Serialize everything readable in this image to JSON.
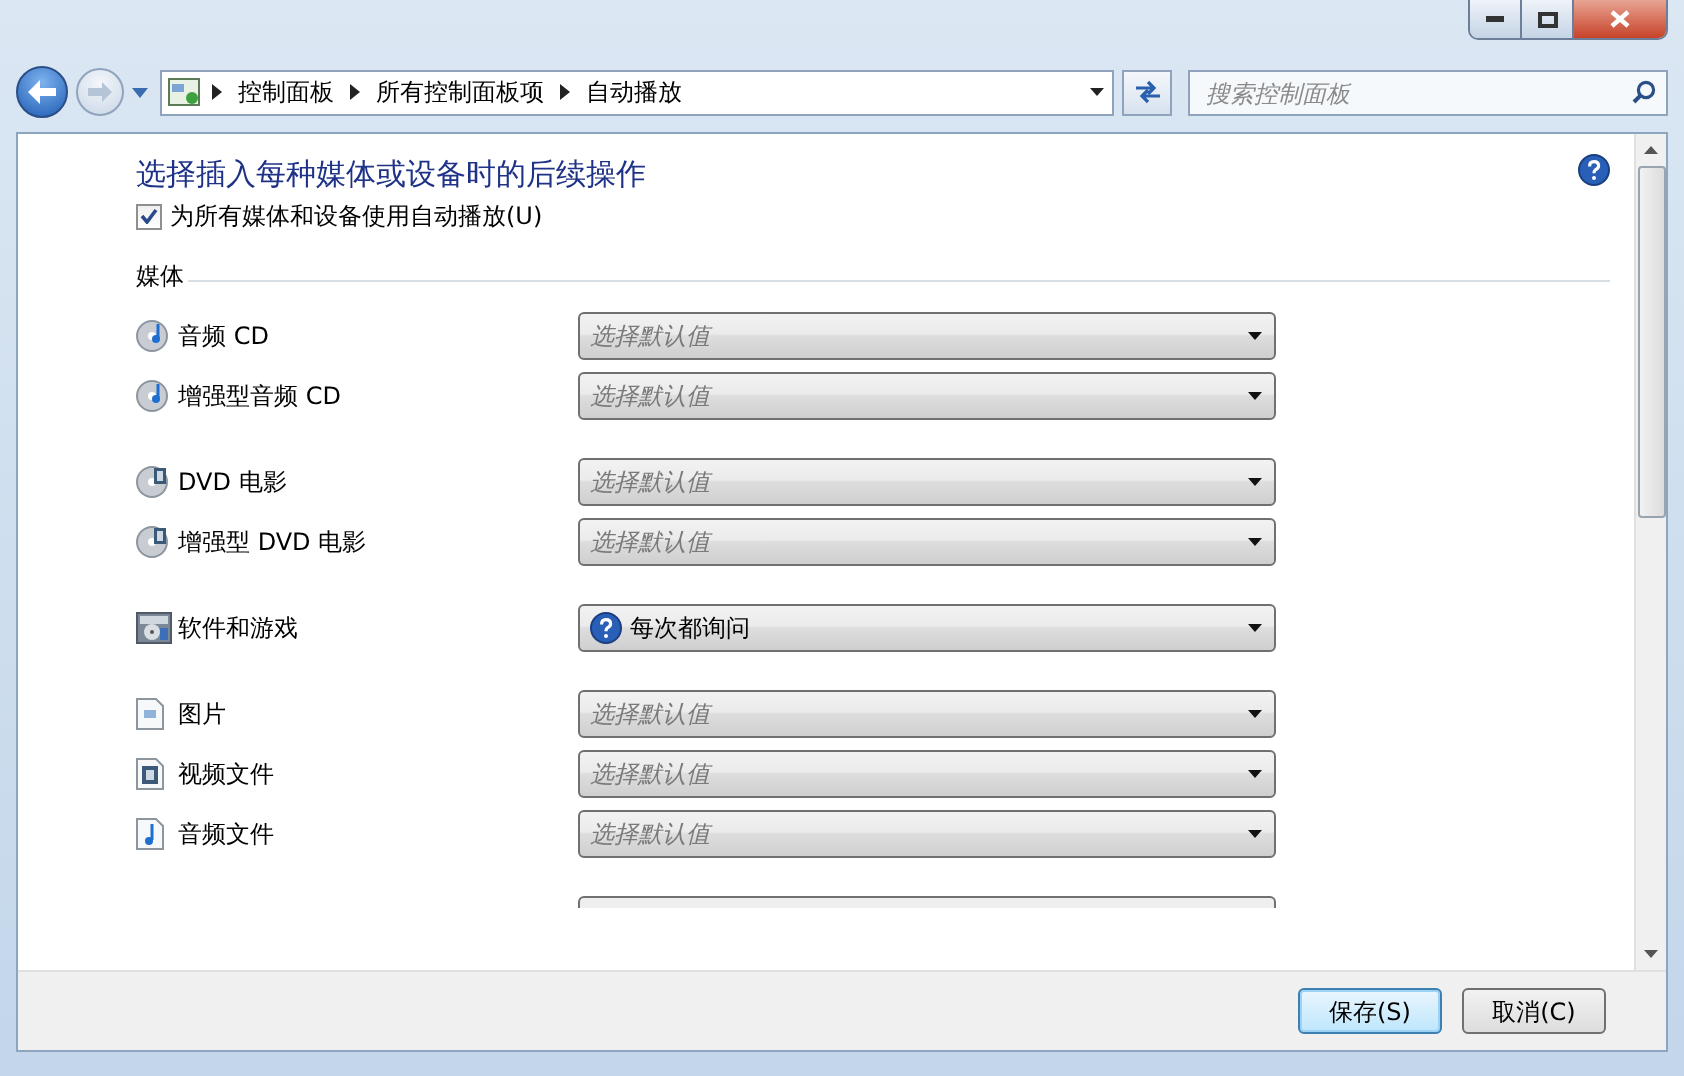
{
  "nav": {
    "back_enabled": true,
    "forward_enabled": false,
    "breadcrumbs": [
      "控制面板",
      "所有控制面板项",
      "自动播放"
    ],
    "search": {
      "placeholder": "搜索控制面板"
    }
  },
  "page": {
    "title": "选择插入每种媒体或设备时的后续操作",
    "use_autoplay": {
      "label": "为所有媒体和设备使用自动播放(U)",
      "checked": true
    },
    "section": "媒体",
    "groups": [
      {
        "items": [
          {
            "kind": "audio-cd",
            "label": "音频 CD",
            "placeholder": "选择默认值"
          },
          {
            "kind": "audio-cd",
            "label": "增强型音频 CD",
            "placeholder": "选择默认值"
          }
        ]
      },
      {
        "items": [
          {
            "kind": "dvd",
            "label": "DVD 电影",
            "placeholder": "选择默认值"
          },
          {
            "kind": "dvd",
            "label": "增强型 DVD 电影",
            "placeholder": "选择默认值"
          }
        ]
      },
      {
        "items": [
          {
            "kind": "software",
            "label": "软件和游戏",
            "value": "每次都询问"
          }
        ]
      },
      {
        "items": [
          {
            "kind": "picture",
            "label": "图片",
            "placeholder": "选择默认值"
          },
          {
            "kind": "video",
            "label": "视频文件",
            "placeholder": "选择默认值"
          },
          {
            "kind": "music",
            "label": "音频文件",
            "placeholder": "选择默认值"
          }
        ]
      }
    ]
  },
  "buttons": [
    {
      "label": "保存(S)",
      "default": true
    },
    {
      "label": "取消(C)",
      "default": false
    }
  ]
}
